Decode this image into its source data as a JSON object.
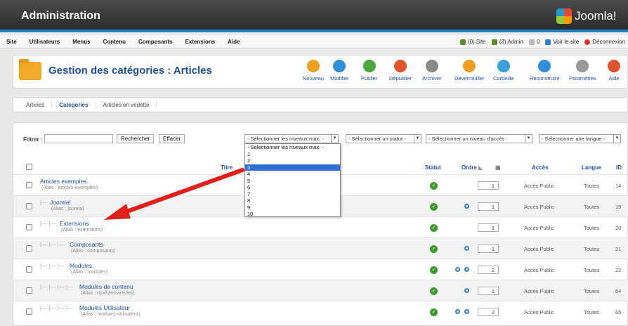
{
  "header": {
    "title": "Administration",
    "logo_text": "Joomla!"
  },
  "menu": {
    "items": [
      "Site",
      "Utilisateurs",
      "Menus",
      "Contenu",
      "Composants",
      "Extensions",
      "Aide"
    ],
    "status": {
      "site": "(0) Site",
      "admin": "(3) Admin",
      "messages": "0",
      "voir": "Voir le site",
      "logout": "Déconnexion"
    }
  },
  "toolbar": {
    "title": "Gestion des catégories : Articles",
    "buttons": [
      {
        "label": "Nouveau",
        "icon": "plus-icon",
        "color": "#f0a020"
      },
      {
        "label": "Modifier",
        "icon": "pencil-icon",
        "color": "#2f8fd8"
      },
      {
        "label": "Publier",
        "icon": "check-icon",
        "color": "#4aa83a"
      },
      {
        "label": "Dépublier",
        "icon": "stop-icon",
        "color": "#e2542a"
      },
      {
        "label": "Archiver",
        "icon": "archive-icon",
        "color": "#888888"
      },
      {
        "label": "Déverrouiller",
        "icon": "checkmark-icon",
        "color": "#f0a020"
      },
      {
        "label": "Corbeille",
        "icon": "trash-icon",
        "color": "#3aa0d8"
      },
      {
        "label": "Reconstruire",
        "icon": "refresh-icon",
        "color": "#2f8fd8"
      },
      {
        "label": "Paramètres",
        "icon": "params-icon",
        "color": "#999999"
      },
      {
        "label": "Aide",
        "icon": "help-icon",
        "color": "#e2542a"
      }
    ]
  },
  "tabs": [
    "Articles",
    "Catégories",
    "Articles en vedette"
  ],
  "filters": {
    "label": "Filtrer :",
    "search_value": "",
    "search_btn": "Rechercher",
    "clear_btn": "Effacer",
    "levels": "- Sélectionner les niveaux max. -",
    "status": "- Sélectionner un statut -",
    "access": "- Sélectionner un niveau d'accès -",
    "language": "- Sélectionner une langue -"
  },
  "dropdown": {
    "options": [
      "- Sélectionner les niveaux max. -",
      "1",
      "2",
      "3",
      "4",
      "5",
      "6",
      "7",
      "8",
      "9",
      "10"
    ],
    "highlighted": "3"
  },
  "table": {
    "headers": {
      "titre": "Titre",
      "statut": "Statut",
      "ordre": "Ordre",
      "acces": "Accès",
      "langue": "Langue",
      "id": "ID"
    },
    "rows": [
      {
        "name": "Articles exemples",
        "alias": "(Alias : articles-exemples)",
        "level": 0,
        "order": "1",
        "acces": "Accès Public",
        "langue": "Toutes",
        "id": "14",
        "arrows": 0
      },
      {
        "name": "Joomla!",
        "alias": "(Alias : joomla)",
        "level": 1,
        "order": "1",
        "acces": "Accès Public",
        "langue": "Toutes",
        "id": "19",
        "arrows": 1
      },
      {
        "name": "Extensions",
        "alias": "(Alias : extensions)",
        "level": 2,
        "order": "1",
        "acces": "Accès Public",
        "langue": "Toutes",
        "id": "20",
        "arrows": 0
      },
      {
        "name": "Composants",
        "alias": "(Alias : composants)",
        "level": 3,
        "order": "1",
        "acces": "Accès Public",
        "langue": "Toutes",
        "id": "21",
        "arrows": 1
      },
      {
        "name": "Modules",
        "alias": "(Alias : modules)",
        "level": 3,
        "order": "2",
        "acces": "Accès Public",
        "langue": "Toutes",
        "id": "22",
        "arrows": 2
      },
      {
        "name": "Modules de contenu",
        "alias": "(Alias : modules-articles)",
        "level": 4,
        "order": "1",
        "acces": "Accès Public",
        "langue": "Toutes",
        "id": "64",
        "arrows": 1
      },
      {
        "name": "Modules Utilisateur",
        "alias": "(Alias : modules-utilisateur)",
        "level": 4,
        "order": "2",
        "acces": "Accès Public",
        "langue": "Toutes",
        "id": "65",
        "arrows": 2
      }
    ]
  }
}
